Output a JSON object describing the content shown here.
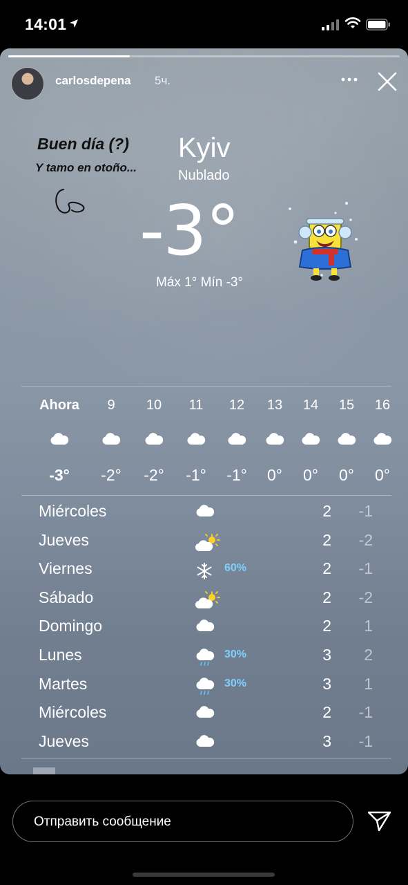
{
  "status_bar": {
    "time": "14:01"
  },
  "story": {
    "progress": 0.31,
    "username": "carlosdepena",
    "posted_ago": "5ч.",
    "captions": [
      "Buen día (?)",
      "Y tamo en otoño..."
    ]
  },
  "weather": {
    "city": "Kyiv",
    "condition": "Nublado",
    "temperature": "-3°",
    "max_min": "Máx 1° Mín -3°",
    "hourly": [
      {
        "label": "Ahora",
        "icon": "cloud-icon",
        "temp": "-3°"
      },
      {
        "label": "9",
        "icon": "cloud-icon",
        "temp": "-2°"
      },
      {
        "label": "10",
        "icon": "cloud-icon",
        "temp": "-2°"
      },
      {
        "label": "11",
        "icon": "cloud-icon",
        "temp": "-1°"
      },
      {
        "label": "12",
        "icon": "cloud-icon",
        "temp": "-1°"
      },
      {
        "label": "13",
        "icon": "cloud-icon",
        "temp": "0°"
      },
      {
        "label": "14",
        "icon": "cloud-icon",
        "temp": "0°"
      },
      {
        "label": "15",
        "icon": "cloud-icon",
        "temp": "0°"
      },
      {
        "label": "16",
        "icon": "cloud-icon",
        "temp": "0°"
      }
    ],
    "daily": [
      {
        "day": "Miércoles",
        "icon": "cloud-icon",
        "prob": "",
        "high": "2",
        "low": "-1"
      },
      {
        "day": "Jueves",
        "icon": "partly-sunny-icon",
        "prob": "",
        "high": "2",
        "low": "-2"
      },
      {
        "day": "Viernes",
        "icon": "snowflake-icon",
        "prob": "60%",
        "high": "2",
        "low": "-1"
      },
      {
        "day": "Sábado",
        "icon": "partly-sunny-icon",
        "prob": "",
        "high": "2",
        "low": "-2"
      },
      {
        "day": "Domingo",
        "icon": "cloud-icon",
        "prob": "",
        "high": "2",
        "low": "1"
      },
      {
        "day": "Lunes",
        "icon": "cloud-rain-icon",
        "prob": "30%",
        "high": "3",
        "low": "2"
      },
      {
        "day": "Martes",
        "icon": "cloud-rain-icon",
        "prob": "30%",
        "high": "3",
        "low": "1"
      },
      {
        "day": "Miércoles",
        "icon": "cloud-icon",
        "prob": "",
        "high": "2",
        "low": "-1"
      },
      {
        "day": "Jueves",
        "icon": "cloud-icon",
        "prob": "",
        "high": "3",
        "low": "-1"
      }
    ]
  },
  "reply": {
    "placeholder": "Отправить сообщение"
  },
  "colors": {
    "probability": "#7fd0ff",
    "card_top": "#8f9aa4",
    "card_bottom": "#6a788a"
  }
}
